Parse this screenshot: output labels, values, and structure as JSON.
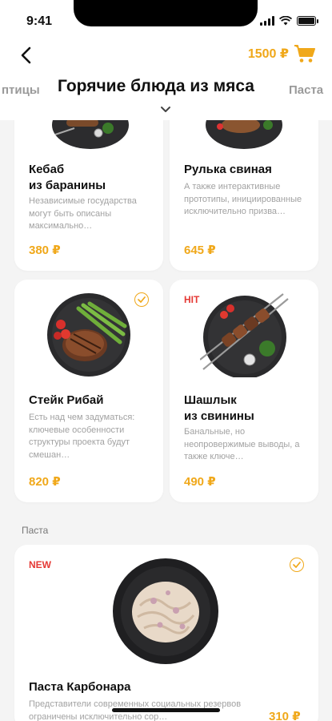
{
  "status_bar": {
    "time": "9:41"
  },
  "header": {
    "cart_total": "1500 ₽"
  },
  "categories": {
    "prev": "птицы",
    "current": "Горячие блюда из мяса",
    "next": "Паста"
  },
  "products": [
    {
      "title": "Кебаб\nиз баранины",
      "desc": "Независимые государства могут быть описаны максимально…",
      "price": "380 ₽"
    },
    {
      "title": "Рулька свиная",
      "desc": "А также интерактивные прототипы, инициированные исключительно призва…",
      "price": "645 ₽"
    },
    {
      "title": "Стейк Рибай",
      "desc": "Есть над чем задуматься: ключевые особенности структуры проекта будут смешан…",
      "price": "820 ₽"
    },
    {
      "badge": "HIT",
      "title": "Шашлык\nиз свинины",
      "desc": "Банальные, но неопровержимые выводы, а также ключе…",
      "price": "490 ₽"
    }
  ],
  "pasta_section": {
    "label": "Паста",
    "item": {
      "badge": "NEW",
      "title": "Паста Карбонара",
      "desc": "Представители современных социальных резервов ограничены исключительно сор…",
      "price": "310 ₽"
    }
  },
  "colors": {
    "accent": "#f0a81a",
    "badge_red": "#e53935",
    "background": "#f4f4f4"
  },
  "icons": [
    "back-arrow-icon",
    "cart-icon",
    "chevron-down-icon",
    "check-circle-icon",
    "signal-icon",
    "wifi-icon",
    "battery-icon"
  ]
}
